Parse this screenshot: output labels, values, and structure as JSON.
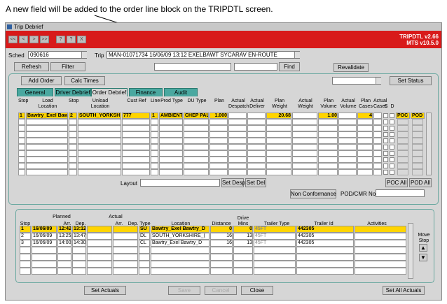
{
  "caption": "A new field will be added to the order line block on the TRIPDTL  screen.",
  "window": {
    "title": "Trip Debrief",
    "screen_code": "TRIPDTL v2.66",
    "version": "MTS v10.5.0"
  },
  "toolbar": {
    "first": "<<",
    "prev": "<",
    "next": ">",
    "last": ">>",
    "help": "?",
    "qmark": "?",
    "exit": "X"
  },
  "header": {
    "sched_label": "Sched",
    "sched_value": "090616",
    "trip_label": "Trip",
    "trip_value": "MAN-01071734 16/06/09 13:12 EXELBAWT    SYCARAV     EN-ROUTE",
    "refresh": "Refresh",
    "filter": "Filter",
    "find": "Find",
    "revalidate": "Revalidate"
  },
  "actions": {
    "add_order": "Add Order",
    "calc_times": "Calc Times",
    "set_status": "Set Status"
  },
  "tabs": [
    "General",
    "Driver Debrief",
    "Order Debrief",
    "Finance",
    "Audit"
  ],
  "order_columns": {
    "stop": "Stop",
    "load_location": "Load\nLocation",
    "stop2": "Stop",
    "unload_location": "Unload\nLocation",
    "cust_ref": "Cust Ref",
    "line": "Line",
    "prod_type": "Prod Type",
    "du_type": "DU Type",
    "plan": "Plan",
    "actual_despatch": "Actual\nDespatch",
    "actual_deliver": "Actual\nDeliver",
    "plan_weight": "Plan\nWeight",
    "actual_weight": "Actual\nWeight",
    "plan_volume": "Plan\nVolume",
    "actual_volume": "Actual\nVolume",
    "plan_cases": "Plan\nCases",
    "actual_cases": "Actual\nCases",
    "c": "C",
    "d": "D"
  },
  "order_row": {
    "stop": "1",
    "load_location": "Bawtry_Exel Baw",
    "stop2": "2",
    "unload_location": "SOUTH_YORKSH",
    "cust_ref": "777",
    "line": "1",
    "prod_type": "AMBIENT",
    "du_type": "CHEP PAL",
    "plan": "1.000",
    "plan_weight": "20.68",
    "plan_volume": "1.00",
    "plan_cases": "4",
    "poc": "POC",
    "pod": "POD"
  },
  "order_footer": {
    "layout_label": "Layout",
    "set_desp": "Set Desp",
    "set_del": "Set Del",
    "poc_all": "POC All",
    "pod_all": "POD All",
    "non_conformance": "Non Conformance",
    "pod_cmr_label": "POD/CMR No"
  },
  "stop_columns": {
    "stop": "Stop",
    "planned": "Planned",
    "arr": "Arr.",
    "dep": "Dep.",
    "actual": "Actual",
    "arr2": "Arr.",
    "dep2": "Dep.",
    "type": "Type",
    "location": "Location",
    "distance": "Distance",
    "drive_mins": "Drive\nMins",
    "trailer_type": "Trailer Type",
    "trailer_id": "Trailer Id",
    "activities": "Activities"
  },
  "stops": [
    {
      "stop": "1",
      "date": "16/06/09",
      "arr": "12:42",
      "dep": "13:12",
      "type": "SU",
      "location": "Bawtry_Exel Bawtry_D",
      "distance": "0",
      "mins": "0",
      "trailer_type": "45FT",
      "trailer_id": "442305"
    },
    {
      "stop": "2",
      "date": "16/06/09",
      "arr": "13:25",
      "dep": "13:47",
      "type": "DL",
      "location": "SOUTH_YORKSHIRE_(",
      "distance": "16",
      "mins": "13",
      "trailer_type": "45FT",
      "trailer_id": "442305"
    },
    {
      "stop": "3",
      "date": "16/06/09",
      "arr": "14:00",
      "dep": "14:30",
      "type": "CL",
      "location": "Bawtry_Exel Bawtry_D",
      "distance": "16",
      "mins": "13",
      "trailer_type": "45FT",
      "trailer_id": "442305"
    }
  ],
  "move_stop": "Move\nStop",
  "bottom": {
    "set_actuals": "Set Actuals",
    "save": "Save",
    "cancel": "Cancel",
    "close": "Close",
    "set_all_actuals": "Set All Actuals"
  }
}
